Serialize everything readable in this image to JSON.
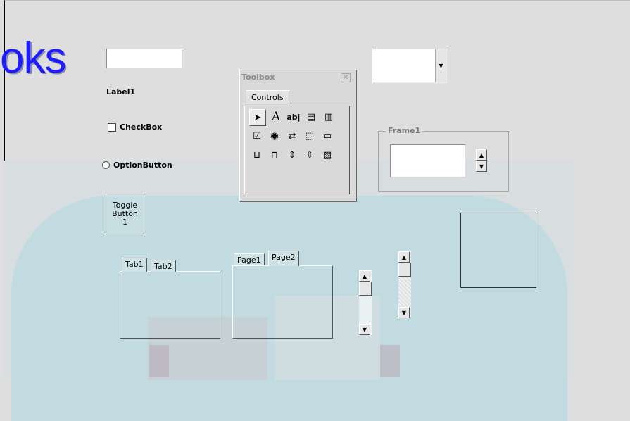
{
  "heading_text": "oks",
  "label1": "Label1",
  "checkbox_label": "CheckBox",
  "optionbutton_label": "OptionButton",
  "toggle_button_lines": [
    "Toggle",
    "Button",
    "1"
  ],
  "tabstrip_tabs": [
    "Tab1",
    "Tab2"
  ],
  "multipage_tabs": [
    "Page1",
    "Page2"
  ],
  "frame_caption": "Frame1",
  "toolbox": {
    "title": "Toolbox",
    "tab_label": "Controls",
    "tools_row1": [
      "select-pointer-icon",
      "label-A-icon",
      "textbox-ab-icon",
      "combobox-icon",
      "listbox-icon"
    ],
    "tools_row2": [
      "checkbox-icon",
      "optionbutton-icon",
      "togglebutton-icon",
      "frame-icon",
      "commandbutton-icon"
    ],
    "tools_row3": [
      "tabstrip-icon",
      "multipage-icon",
      "scrollbar-icon",
      "spinbutton-icon",
      "image-icon"
    ]
  },
  "colors": {
    "heading": "#1c1cff",
    "panel": "#c2dbe1"
  }
}
